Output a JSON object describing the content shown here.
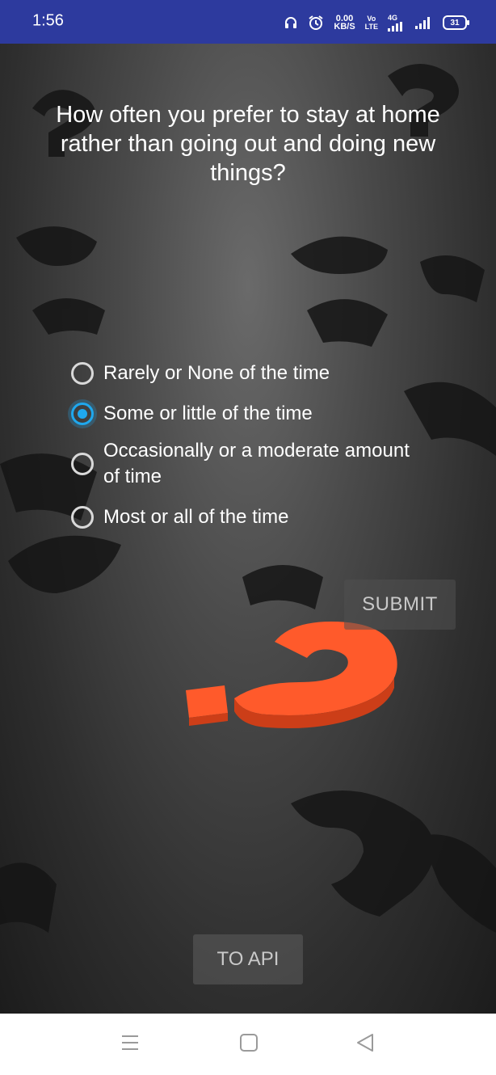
{
  "status_bar": {
    "time": "1:56",
    "net_speed_value": "0.00",
    "net_speed_unit": "KB/S",
    "volte_top": "Vo",
    "volte_bottom": "LTE",
    "network_type": "4G",
    "battery": "31"
  },
  "question": "How often you prefer to stay at home rather than going out and doing new things?",
  "options": [
    {
      "label": "Rarely or None of the time",
      "checked": false
    },
    {
      "label": "Some or little of the time",
      "checked": true
    },
    {
      "label": "Occasionally or a moderate amount of time",
      "checked": false
    },
    {
      "label": "Most or all of the time",
      "checked": false
    }
  ],
  "buttons": {
    "submit": "SUBMIT",
    "to_api": "TO API"
  },
  "colors": {
    "status_bar": "#2d3a9e",
    "radio_accent": "#1fa8ee",
    "question_mark_accent": "#ff5a2b"
  },
  "icons": [
    "headset-icon",
    "alarm-icon",
    "signal-icon",
    "battery-icon",
    "menu-icon",
    "home-square-icon",
    "back-triangle-icon"
  ]
}
